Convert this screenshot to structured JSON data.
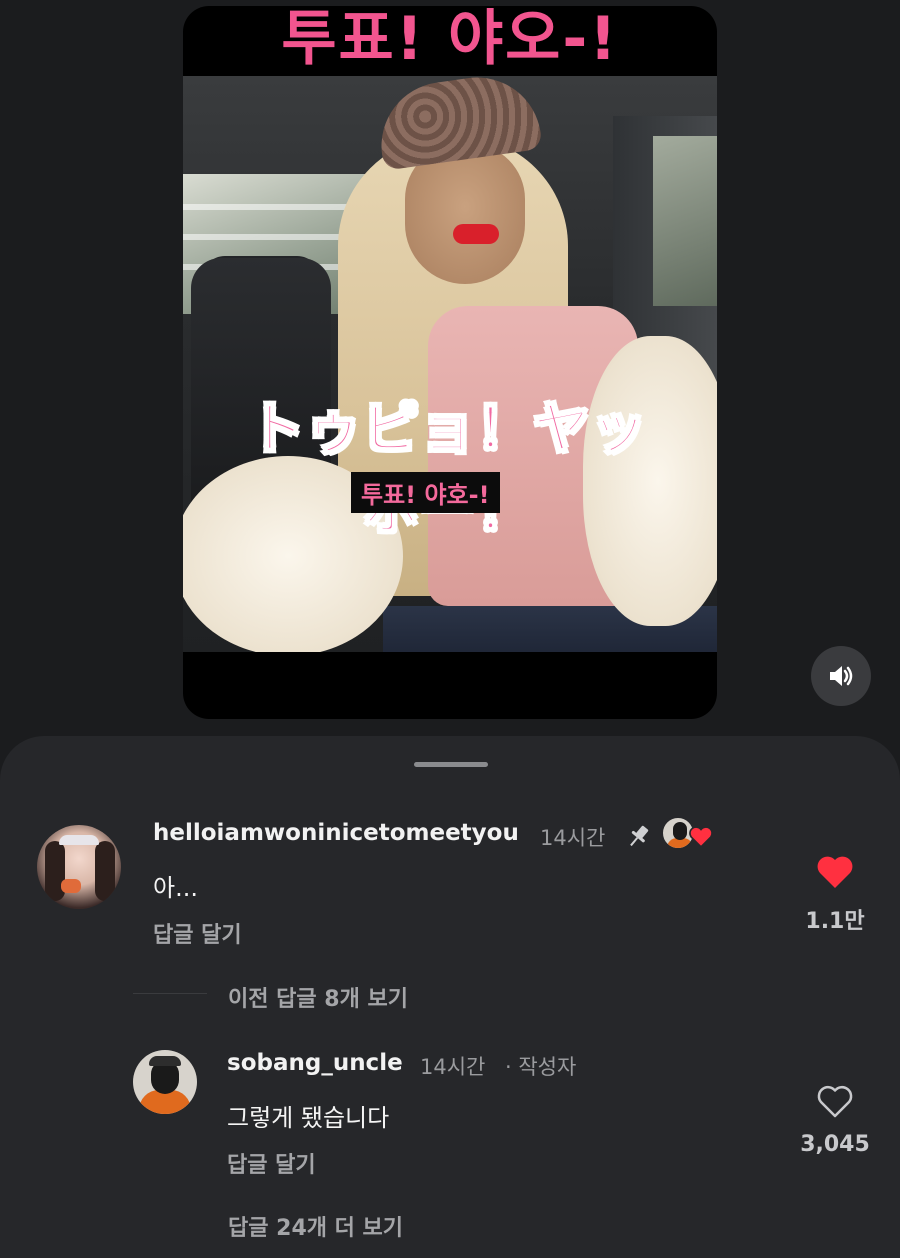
{
  "reel": {
    "banner_text": "투표! 야오-!",
    "jp_caption": "トゥピョ！ヤッホー！",
    "kr_caption": "투표! 야호-!",
    "sound_icon": "speaker-on-icon"
  },
  "comments": [
    {
      "username": "helloiamwoninicetomeetyou",
      "time": "14시간",
      "text": "아...",
      "reply_label": "답글 달기",
      "likes": "1.1만",
      "liked": true,
      "pinned": true,
      "creator_liked": true,
      "view_previous_replies": "이전 답글 8개 보기"
    },
    {
      "username": "sobang_uncle",
      "time": "14시간",
      "author_badge": "· 작성자",
      "text": "그렇게 됐습니다",
      "reply_label": "답글 달기",
      "likes": "3,045",
      "liked": false,
      "more_replies": "답글 24개 더 보기"
    }
  ],
  "colors": {
    "background": "#1b1c1e",
    "sheet": "#26272a",
    "like_red": "#ff3040",
    "caption_pink": "#f2558f"
  }
}
